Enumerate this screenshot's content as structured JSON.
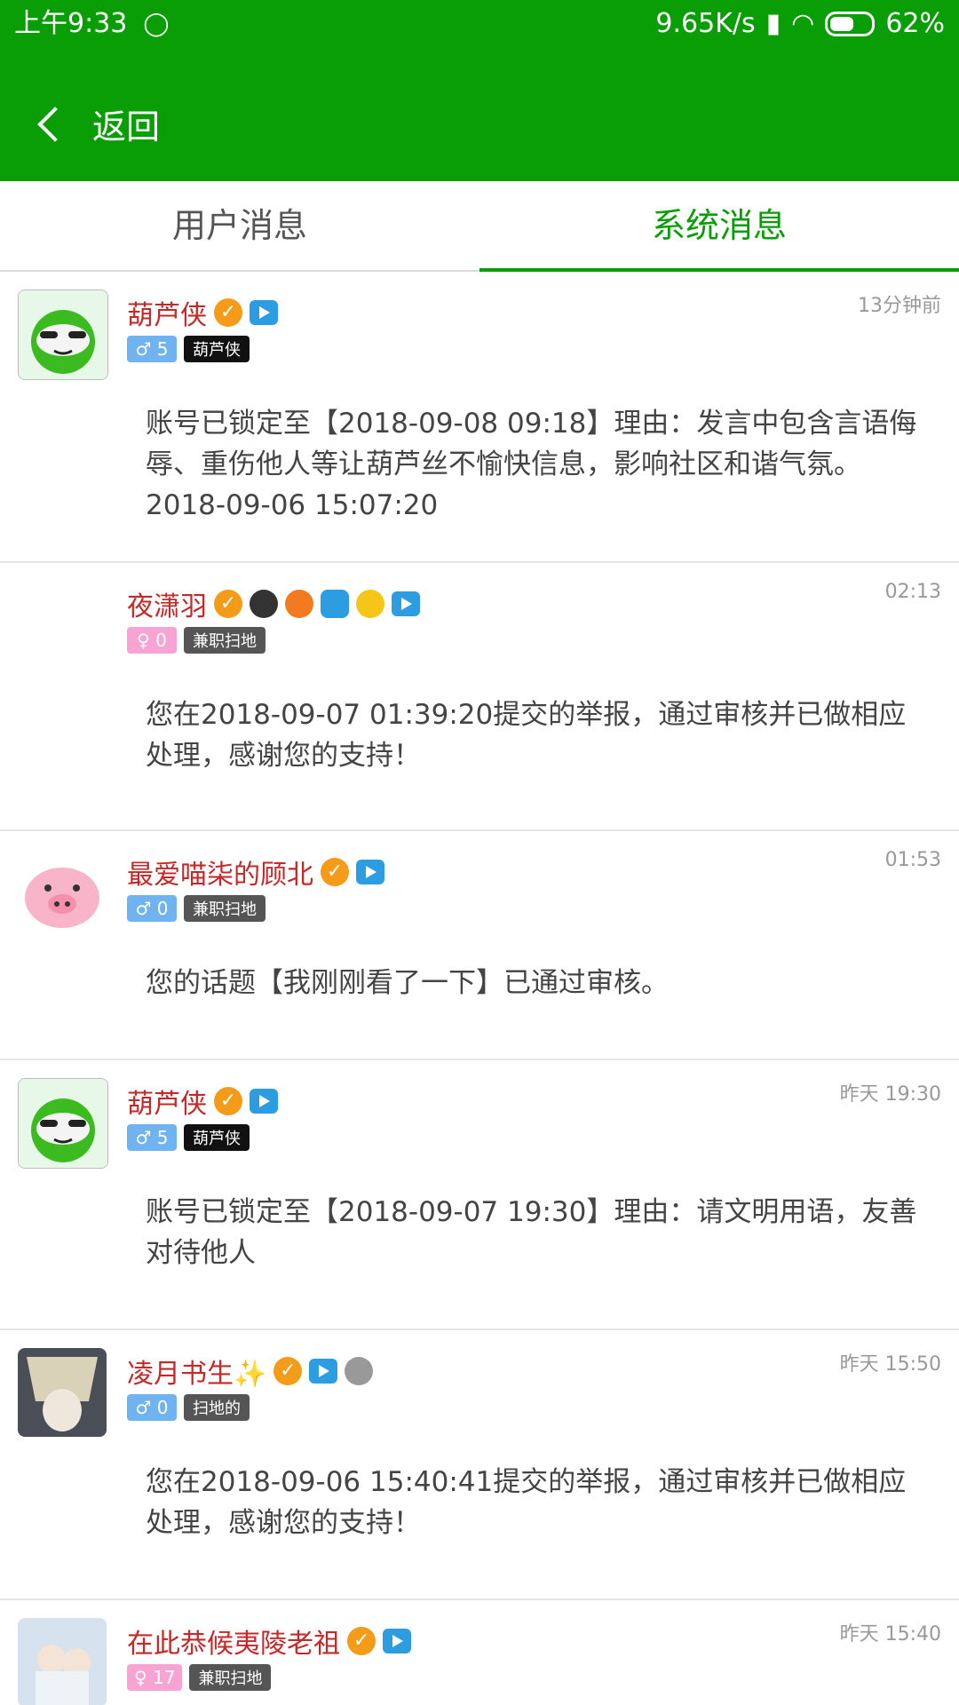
{
  "status_bar": {
    "time": "上午9:33",
    "speed": "9.65K/s",
    "battery": "62%"
  },
  "nav": {
    "back_label": "返回"
  },
  "tabs": [
    {
      "label": "用户消息",
      "active": false
    },
    {
      "label": "系统消息",
      "active": true
    }
  ],
  "messages": [
    {
      "name": "葫芦侠",
      "time": "13分钟前",
      "gender": "male",
      "gender_label": "♂ 5",
      "role": "葫芦侠",
      "role_style": "black",
      "content": "账号已锁定至【2018-09-08 09:18】理由：发言中包含言语侮辱、重伤他人等让葫芦丝不愉快信息，影响社区和谐气氛。2018-09-06 15:07:20"
    },
    {
      "name": "夜潇羽",
      "time": "02:13",
      "gender": "female",
      "gender_label": "♀ 0",
      "role": "兼职扫地",
      "role_style": "gray",
      "content": "您在2018-09-07 01:39:20提交的举报，通过审核并已做相应处理，感谢您的支持！"
    },
    {
      "name": "最爱喵柒的顾北",
      "time": "01:53",
      "gender": "male",
      "gender_label": "♂ 0",
      "role": "兼职扫地",
      "role_style": "gray",
      "content": "您的话题【我刚刚看了一下】已通过审核。"
    },
    {
      "name": "葫芦侠",
      "time": "昨天 19:30",
      "gender": "male",
      "gender_label": "♂ 5",
      "role": "葫芦侠",
      "role_style": "black",
      "content": "账号已锁定至【2018-09-07 19:30】理由：请文明用语，友善对待他人"
    },
    {
      "name": "凌月书生✨",
      "time": "昨天 15:50",
      "gender": "male",
      "gender_label": "♂ 0",
      "role": "扫地的",
      "role_style": "gray",
      "content": "您在2018-09-06 15:40:41提交的举报，通过审核并已做相应处理，感谢您的支持！"
    },
    {
      "name": "在此恭候夷陵老祖",
      "time": "昨天 15:40",
      "gender": "female",
      "gender_label": "♀ 17",
      "role": "兼职扫地",
      "role_style": "gray",
      "content": ""
    }
  ]
}
